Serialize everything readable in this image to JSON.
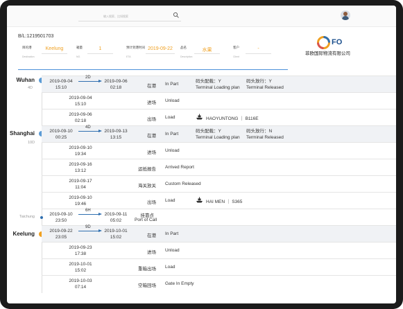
{
  "header": {
    "search_placeholder": "输入搜索、比如搜索"
  },
  "bl_number": "B/L:1219501703",
  "fields": [
    {
      "label": "目的港",
      "sub": "Destination",
      "value": "Keelung"
    },
    {
      "label": "箱量",
      "sub": "NO.",
      "value": "1"
    },
    {
      "label": "预计到港时间",
      "sub": "ETA",
      "value": "2019-09-22"
    },
    {
      "label": "品名",
      "sub": "Description",
      "value": "水果"
    },
    {
      "label": "客户",
      "sub": "Client",
      "value": "-"
    }
  ],
  "logo": {
    "mark": "FO",
    "company": "菲欧国际物流有限公司"
  },
  "ports": [
    {
      "name": "Wuhan",
      "days": "4D"
    },
    {
      "name": "Shanghai",
      "days": "10D"
    },
    {
      "name": "Taichung",
      "days": ""
    },
    {
      "name": "Keelung",
      "days": ""
    }
  ],
  "rows": [
    {
      "from": "2019-09-04 15:10",
      "to": "2019-09-06 02:18",
      "duration": "2D",
      "cn": "在港",
      "en": "In Part",
      "extra1": "码头配载：Y",
      "extra2": "Terminal Loading plan",
      "extra3": "码头放行：Y",
      "extra4": "Terminal Released"
    },
    {
      "from": "2019-09-04 15:10",
      "cn": "进场",
      "en": "Unload"
    },
    {
      "from": "2019-09-06 02:18",
      "cn": "出场",
      "en": "Load",
      "vessel": "HAOYUNTONG ｜ B116E"
    },
    {
      "from": "2019-09-10 00:25",
      "to": "2019-09-13 13:15",
      "duration": "4D",
      "cn": "在港",
      "en": "In Part",
      "extra1": "码头配载：Y",
      "extra2": "Terminal Loading plan",
      "extra3": "码头放行：N",
      "extra4": "Terminal Released"
    },
    {
      "from": "2019-09-10 19:34",
      "cn": "进场",
      "en": "Unload"
    },
    {
      "from": "2019-09-16 13:12",
      "cn": "运抵报告",
      "en": "Arrived Report"
    },
    {
      "from": "2019-09-17 11:04",
      "cn": "海关放关",
      "en": "Custom Released"
    },
    {
      "from": "2019-09-10 19:46",
      "cn": "出场",
      "en": "Load",
      "vessel": "HAI MEN ｜ S365"
    },
    {
      "from": "2019-09-10 23:50",
      "to": "2019-09-11 05:02",
      "duration": "6H",
      "cn": "挂靠点",
      "en": "Port of Call"
    },
    {
      "from": "2019-09-22 23:05",
      "to": "2019-10-01 15:02",
      "duration": "9D",
      "cn": "在港",
      "en": "In Part"
    },
    {
      "from": "2019-09-23 17:38",
      "cn": "进场",
      "en": "Unload"
    },
    {
      "from": "2019-10-01 15:02",
      "cn": "重箱出场",
      "en": "Load"
    },
    {
      "from": "2019-10-03 07:14",
      "cn": "空箱回场",
      "en": "Gate In Empty"
    }
  ],
  "colors": {
    "accent": "#2f6fb0",
    "orange": "#f0a020",
    "blue_node": "#5b9bd5",
    "highlight_row": "#f0f2f5"
  }
}
